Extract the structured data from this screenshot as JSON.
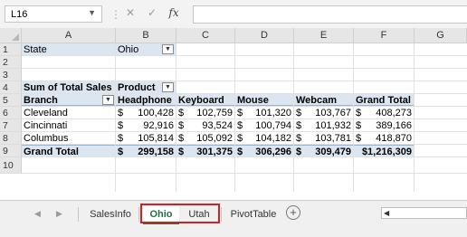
{
  "formula_bar": {
    "name_box": "L16",
    "cancel": "✕",
    "enter": "✓",
    "fx": "fx",
    "formula": ""
  },
  "columns": [
    "A",
    "B",
    "C",
    "D",
    "E",
    "F",
    "G"
  ],
  "rows": [
    "1",
    "2",
    "3",
    "4",
    "5",
    "6",
    "7",
    "8",
    "9",
    "10"
  ],
  "filter": {
    "label": "State",
    "value": "Ohio"
  },
  "pivot": {
    "title": "Sum of Total Sales",
    "col_label": "Product",
    "row_label": "Branch",
    "headers": [
      "Headphone",
      "Keyboard",
      "Mouse",
      "Webcam",
      "Grand Total"
    ],
    "currency": "$",
    "rows": [
      {
        "branch": "Cleveland",
        "values": [
          "100,428",
          "102,759",
          "101,320",
          "103,767",
          "408,273"
        ]
      },
      {
        "branch": "Cincinnati",
        "values": [
          "92,916",
          "93,524",
          "100,794",
          "101,932",
          "389,166"
        ]
      },
      {
        "branch": "Columbus",
        "values": [
          "105,814",
          "105,092",
          "104,182",
          "103,781",
          "418,870"
        ]
      }
    ],
    "total": {
      "branch": "Grand Total",
      "values": [
        "299,158",
        "301,375",
        "306,296",
        "309,479"
      ],
      "grand": "$1,216,309"
    }
  },
  "sheets": {
    "tabs": [
      "SalesInfo",
      "Ohio",
      "Utah",
      "PivotTable"
    ],
    "active": "Ohio",
    "add": "+"
  },
  "colors": {
    "accent": "#217346",
    "highlight": "#dce6f1",
    "outline": "#d42020"
  }
}
